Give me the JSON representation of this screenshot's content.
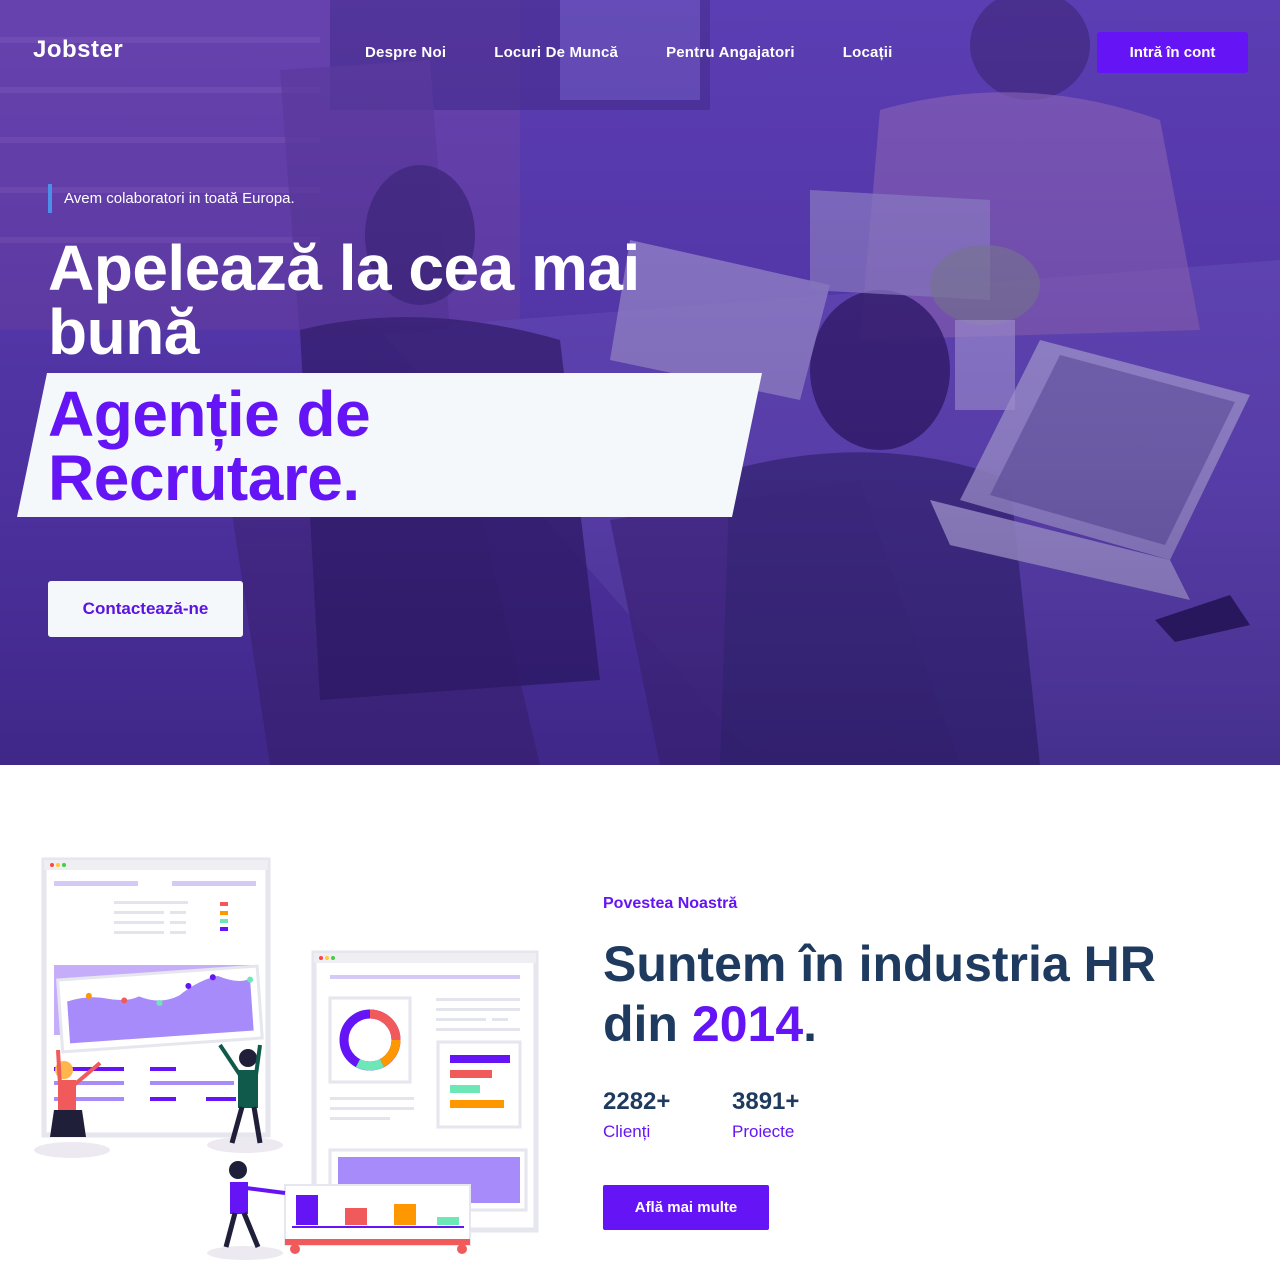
{
  "nav": {
    "logo": "Jobster",
    "links": [
      "Despre Noi",
      "Locuri De Muncă",
      "Pentru Angajatori",
      "Locații"
    ],
    "login_label": "Intră în cont"
  },
  "hero": {
    "eyebrow": "Avem colaboratori in toată Europa.",
    "headline": "Apelează la cea mai bună",
    "highlight_line1": "Agenție de",
    "highlight_line2": "Recrutare.",
    "contact_label": "Contactează-ne"
  },
  "about": {
    "eyebrow": "Povestea Noastră",
    "title_prefix": "Suntem în industria HR din",
    "title_year": "2014",
    "title_suffix": ".",
    "stats": [
      {
        "value": "2282+",
        "label": "Clienți"
      },
      {
        "value": "3891+",
        "label": "Proiecte"
      }
    ],
    "more_label": "Află mai multe"
  },
  "colors": {
    "accent": "#6514f5",
    "heading": "#1e3a5f",
    "eyebrow_bar": "#4b8fe8"
  },
  "icons": {
    "illustration": "team-analytics-illustration",
    "hero_background": "office-team-photo"
  }
}
